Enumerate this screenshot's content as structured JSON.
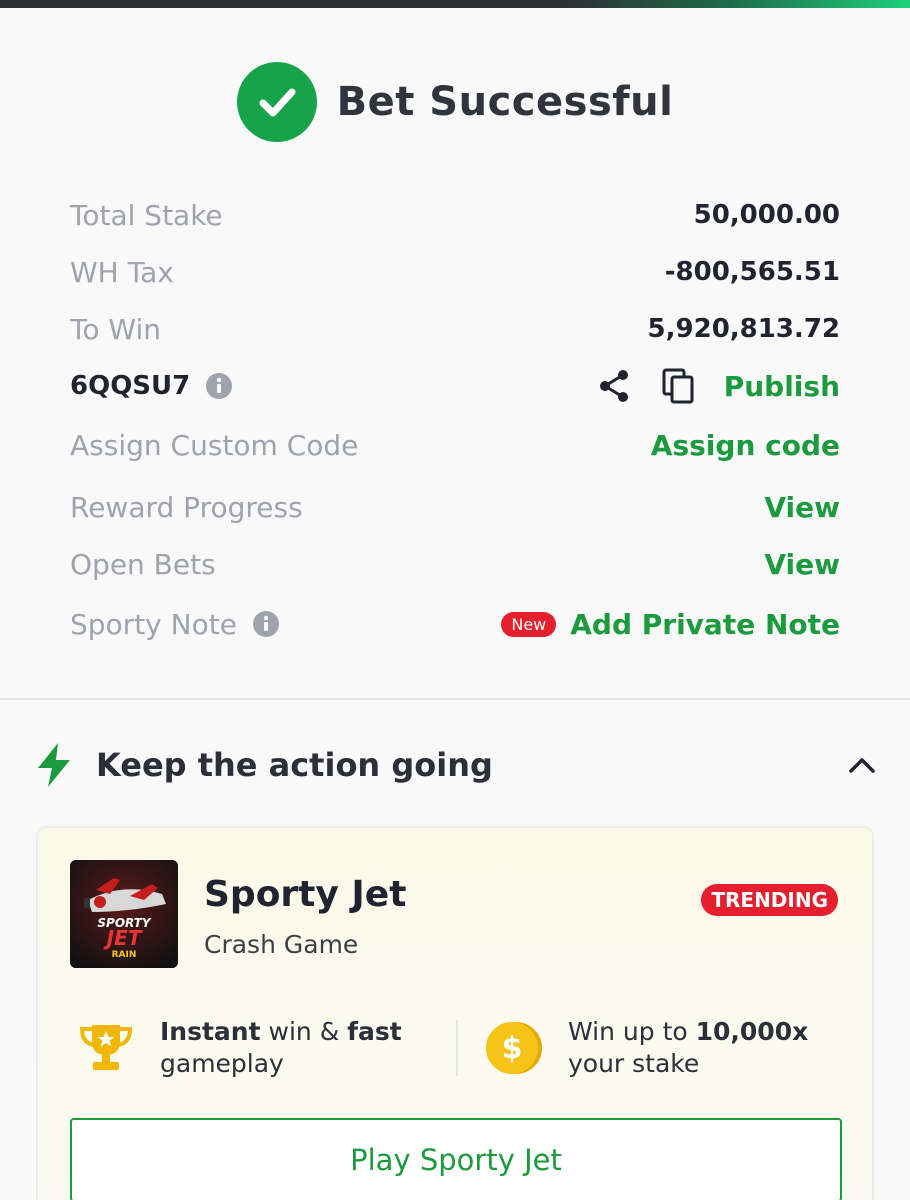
{
  "header": {
    "title": "Bet Successful"
  },
  "details": {
    "total_stake": {
      "label": "Total Stake",
      "value": "50,000.00"
    },
    "wh_tax": {
      "label": "WH Tax",
      "value": "-800,565.51"
    },
    "to_win": {
      "label": "To Win",
      "value": "5,920,813.72"
    },
    "booking": {
      "code": "6QQSU7",
      "publish_label": "Publish"
    },
    "custom_code": {
      "label": "Assign Custom Code",
      "action": "Assign code"
    },
    "reward_progress": {
      "label": "Reward Progress",
      "action": "View"
    },
    "open_bets": {
      "label": "Open Bets",
      "action": "View"
    },
    "sporty_note": {
      "label": "Sporty Note",
      "badge": "New",
      "action": "Add Private Note"
    }
  },
  "promo": {
    "section_title": "Keep the action going",
    "game": {
      "title": "Sporty Jet",
      "subtitle": "Crash Game",
      "badge": "TRENDING",
      "thumb_text_top": "SPORTY",
      "thumb_text_mid": "JET",
      "thumb_text_bottom": "RAIN"
    },
    "features": [
      {
        "icon": "trophy-icon",
        "bold1": "Instant",
        "text1": " win & ",
        "bold2": "fast",
        "line2": "gameplay"
      },
      {
        "icon": "coin-icon",
        "text1": "Win up to ",
        "bold1": "10,000x",
        "line2": "your stake"
      }
    ],
    "cta_label": "Play Sporty Jet"
  },
  "colors": {
    "green": "#1b9a3e",
    "red": "#e41f2e",
    "check_green": "#17a34a"
  }
}
